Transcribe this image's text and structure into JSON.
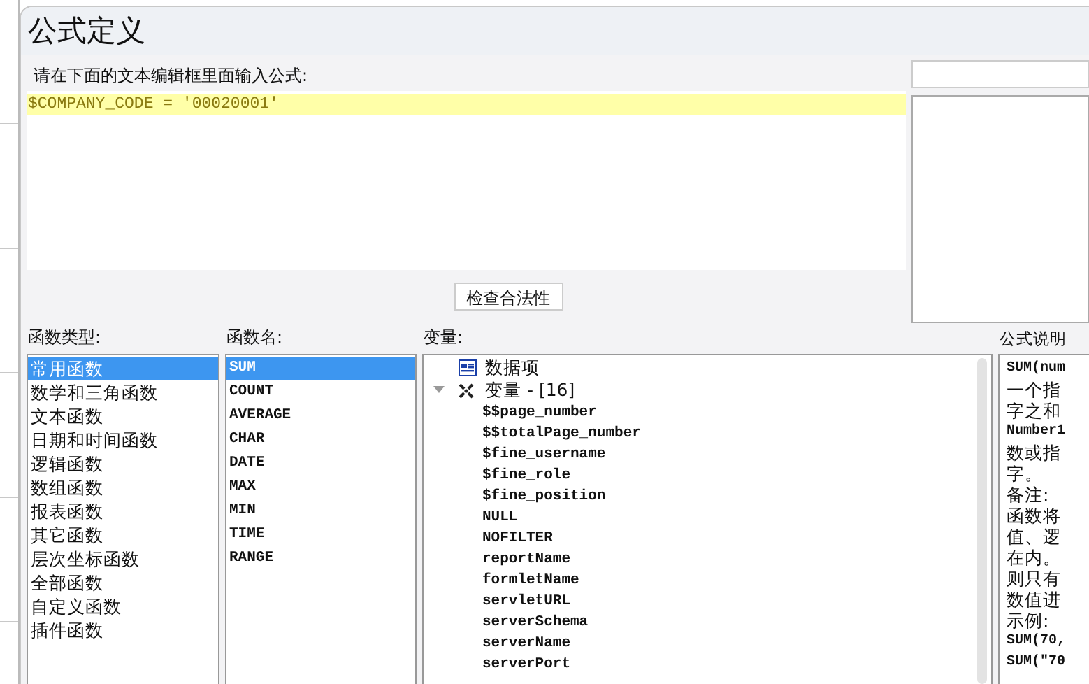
{
  "dialog": {
    "title": "公式定义"
  },
  "editor": {
    "label": "请在下面的文本编辑框里面输入公式:",
    "lines": [
      {
        "text": "$COMPANY_CODE = '00020001'",
        "highlighted": true
      }
    ]
  },
  "check_button": {
    "label": "检查合法性"
  },
  "function_types": {
    "label": "函数类型:",
    "items": [
      {
        "label": "常用函数",
        "selected": true
      },
      {
        "label": "数学和三角函数",
        "selected": false
      },
      {
        "label": "文本函数",
        "selected": false
      },
      {
        "label": "日期和时间函数",
        "selected": false
      },
      {
        "label": "逻辑函数",
        "selected": false
      },
      {
        "label": "数组函数",
        "selected": false
      },
      {
        "label": "报表函数",
        "selected": false
      },
      {
        "label": "其它函数",
        "selected": false
      },
      {
        "label": "层次坐标函数",
        "selected": false
      },
      {
        "label": "全部函数",
        "selected": false
      },
      {
        "label": "自定义函数",
        "selected": false
      },
      {
        "label": "插件函数",
        "selected": false
      }
    ]
  },
  "function_names": {
    "label": "函数名:",
    "items": [
      {
        "label": "SUM",
        "selected": true
      },
      {
        "label": "COUNT",
        "selected": false
      },
      {
        "label": "AVERAGE",
        "selected": false
      },
      {
        "label": "CHAR",
        "selected": false
      },
      {
        "label": "DATE",
        "selected": false
      },
      {
        "label": "MAX",
        "selected": false
      },
      {
        "label": "MIN",
        "selected": false
      },
      {
        "label": "TIME",
        "selected": false
      },
      {
        "label": "RANGE",
        "selected": false
      }
    ]
  },
  "variables": {
    "label": "变量:",
    "tree": [
      {
        "label": "数据项",
        "kind": "data"
      },
      {
        "label": "变量 - [16]",
        "kind": "variable",
        "expanded": true,
        "children": [
          {
            "label": "$$page_number"
          },
          {
            "label": "$$totalPage_number"
          },
          {
            "label": "$fine_username"
          },
          {
            "label": "$fine_role"
          },
          {
            "label": "$fine_position"
          },
          {
            "label": "NULL"
          },
          {
            "label": "NOFILTER"
          },
          {
            "label": "reportName"
          },
          {
            "label": "formletName"
          },
          {
            "label": "servletURL"
          },
          {
            "label": "serverSchema"
          },
          {
            "label": "serverName"
          },
          {
            "label": "serverPort"
          }
        ]
      }
    ]
  },
  "description": {
    "label": "公式说明",
    "lines": [
      {
        "text": "SUM(num",
        "kind": "code"
      },
      {
        "text": "一个指",
        "kind": "text"
      },
      {
        "text": "字之和",
        "kind": "text"
      },
      {
        "text": "Number1",
        "kind": "code"
      },
      {
        "text": "数或指",
        "kind": "text"
      },
      {
        "text": "字。",
        "kind": "text"
      },
      {
        "text": "备注:",
        "kind": "text"
      },
      {
        "text": "函数将",
        "kind": "text"
      },
      {
        "text": "值、逻",
        "kind": "text"
      },
      {
        "text": "在内。",
        "kind": "text"
      },
      {
        "text": "则只有",
        "kind": "text"
      },
      {
        "text": "数值进",
        "kind": "text"
      },
      {
        "text": "示例:",
        "kind": "text"
      },
      {
        "text": "SUM(70,",
        "kind": "code"
      },
      {
        "text": "SUM(\"70",
        "kind": "code"
      }
    ]
  }
}
